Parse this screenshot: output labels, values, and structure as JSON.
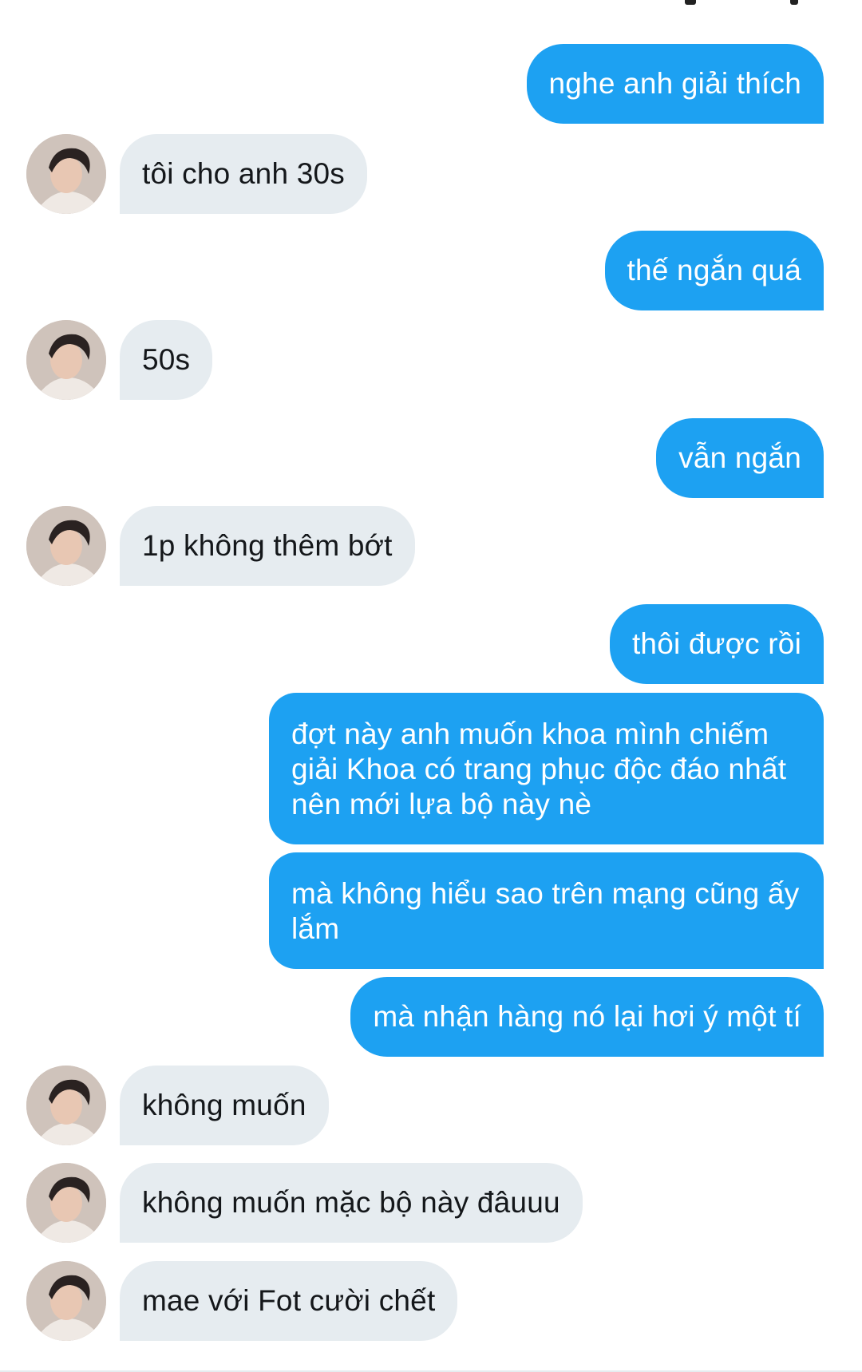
{
  "conversation": {
    "messages": [
      {
        "id": "m1",
        "direction": "outgoing",
        "text": "nghe anh giải thích"
      },
      {
        "id": "m2",
        "direction": "incoming",
        "text": "tôi cho anh 30s"
      },
      {
        "id": "m3",
        "direction": "outgoing",
        "text": "thế ngắn quá"
      },
      {
        "id": "m4",
        "direction": "incoming",
        "text": "50s"
      },
      {
        "id": "m5",
        "direction": "outgoing",
        "text": "vẫn ngắn"
      },
      {
        "id": "m6",
        "direction": "incoming",
        "text": "1p không thêm bớt"
      },
      {
        "id": "m7",
        "direction": "outgoing",
        "text": "thôi được rồi"
      },
      {
        "id": "m8",
        "direction": "outgoing",
        "text": "đợt này anh muốn khoa mình chiếm giải Khoa có trang phục độc đáo nhất nên mới lựa bộ này nè"
      },
      {
        "id": "m9",
        "direction": "outgoing",
        "text": "mà không hiểu sao trên mạng cũng ấy lắm"
      },
      {
        "id": "m10",
        "direction": "outgoing",
        "text": "mà nhận hàng nó lại hơi ý một tí"
      },
      {
        "id": "m11",
        "direction": "incoming",
        "text": "không muốn"
      },
      {
        "id": "m12",
        "direction": "incoming",
        "text": "không muốn mặc bộ này đâuuu"
      },
      {
        "id": "m13",
        "direction": "incoming",
        "text": "mae với Fot cười chết"
      }
    ]
  },
  "colors": {
    "outgoing_bubble": "#1da1f2",
    "incoming_bubble": "#e6ecf0",
    "outgoing_text": "#ffffff",
    "incoming_text": "#14171a",
    "background": "#ffffff"
  },
  "icons": {
    "avatar": "contact-avatar-photo"
  }
}
